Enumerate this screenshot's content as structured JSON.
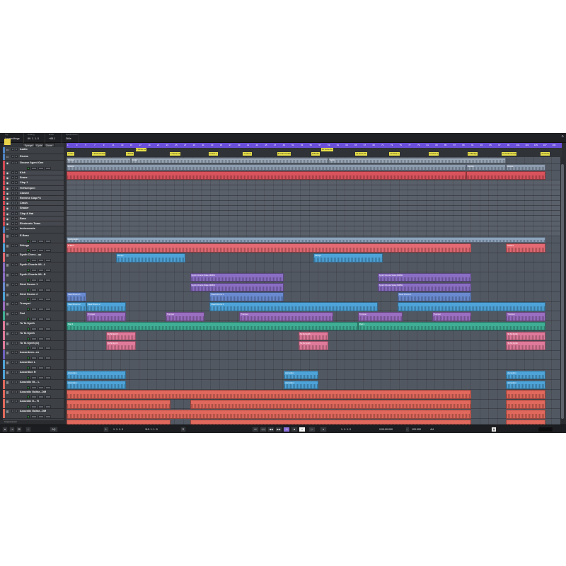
{
  "status": {
    "cells": [
      {
        "label": "Typ",
        "value": "Locatorlänge"
      },
      {
        "label": "Anfang",
        "value": "89. 1. 1. 0"
      },
      {
        "label": "Ende",
        "value": "+85.1"
      },
      {
        "label": "Spielposition",
        "value": "Stille"
      }
    ]
  },
  "tracklist_tabs": [
    "Spiegel",
    "Cycle",
    "Zoom"
  ],
  "tracks": [
    {
      "name": "Audio",
      "color": "#4e84c4",
      "type": "folder",
      "icon": "folder-icon"
    },
    {
      "name": "Drums",
      "color": "#4e84c4",
      "type": "folder",
      "icon": "folder-icon"
    },
    {
      "name": "Groove Agent One",
      "color": "#d24a55",
      "type": "instrument",
      "icon": "drum-icon"
    },
    {
      "name": "Kick",
      "color": "#d24a55",
      "type": "sub",
      "icon": "drum-icon"
    },
    {
      "name": "Snare",
      "color": "#d24a55",
      "type": "sub",
      "icon": "drum-icon"
    },
    {
      "name": "Clap 1",
      "color": "#d24a55",
      "type": "sub",
      "icon": "drum-icon"
    },
    {
      "name": "Hi Hat Open",
      "color": "#d24a55",
      "type": "sub",
      "icon": "drum-icon"
    },
    {
      "name": "Closed",
      "color": "#d24a55",
      "type": "sub",
      "icon": "drum-icon"
    },
    {
      "name": "Reverse Clap FX",
      "color": "#d24a55",
      "type": "sub",
      "icon": "drum-icon"
    },
    {
      "name": "Crash",
      "color": "#d24a55",
      "type": "sub",
      "icon": "drum-icon"
    },
    {
      "name": "Shaker",
      "color": "#d24a55",
      "type": "sub",
      "icon": "drum-icon"
    },
    {
      "name": "Clap & Hat",
      "color": "#d24a55",
      "type": "sub",
      "icon": "drum-icon"
    },
    {
      "name": "Bass",
      "color": "#d24a55",
      "type": "sub",
      "icon": "drum-icon"
    },
    {
      "name": "Electronic Toms",
      "color": "#d24a55",
      "type": "sub",
      "icon": "drum-icon"
    },
    {
      "name": "Instruments",
      "color": "#4e84c4",
      "type": "folder",
      "icon": "folder-icon"
    },
    {
      "name": "E-Bass",
      "color": "#e46a73",
      "type": "instrument",
      "icon": "piano-icon"
    },
    {
      "name": "Strings",
      "color": "#4ea3d8",
      "type": "instrument",
      "icon": "piano-icon"
    },
    {
      "name": "Synth Chrnc...up",
      "color": "#e46a73",
      "type": "instrument",
      "icon": "piano-icon"
    },
    {
      "name": "Synth Chords Wi...L",
      "color": "#8a6ec4",
      "type": "instrument",
      "icon": "piano-icon"
    },
    {
      "name": "Synth Chords Wi...R",
      "color": "#8a6ec4",
      "type": "instrument",
      "icon": "piano-icon"
    },
    {
      "name": "Steel Drums 1",
      "color": "#6a8ad0",
      "type": "instrument",
      "icon": "piano-icon"
    },
    {
      "name": "Steel Drums 2",
      "color": "#4ea3d8",
      "type": "instrument",
      "icon": "piano-icon"
    },
    {
      "name": "Trumpet",
      "color": "#9a6ec0",
      "type": "instrument",
      "icon": "piano-icon"
    },
    {
      "name": "Pad",
      "color": "#3fae95",
      "type": "instrument",
      "icon": "piano-icon"
    },
    {
      "name": "Ta Ta Synth",
      "color": "#e07a9a",
      "type": "instrument",
      "icon": "piano-icon"
    },
    {
      "name": "Ta Ta Synth",
      "color": "#e07a9a",
      "type": "instrument",
      "icon": "piano-icon"
    },
    {
      "name": "Ta Ta Synth (D)",
      "color": "#e07a9a",
      "type": "instrument",
      "icon": "piano-icon"
    },
    {
      "name": "Accordeon...ex",
      "color": "#6e62c0",
      "type": "instrument",
      "icon": "piano-icon"
    },
    {
      "name": "Accordion L",
      "color": "#4ea3d8",
      "type": "instrument",
      "icon": "piano-icon"
    },
    {
      "name": "Accordion R",
      "color": "#4ea3d8",
      "type": "instrument",
      "icon": "piano-icon"
    },
    {
      "name": "Acoustic Gt... L",
      "color": "#e0685c",
      "type": "instrument",
      "icon": "piano-icon"
    },
    {
      "name": "Acoustic Guitar...DM",
      "color": "#e0685c",
      "type": "instrument",
      "icon": "piano-icon"
    },
    {
      "name": "Acoustic G... R",
      "color": "#e0685c",
      "type": "instrument",
      "icon": "piano-icon"
    },
    {
      "name": "Acoustic Guitar...DM",
      "color": "#e0685c",
      "type": "instrument",
      "icon": "piano-icon"
    }
  ],
  "markers": [
    "1 Intro",
    "2 Instrumental",
    "3 Break",
    "4 Verse 1a",
    "5 Verse 1b",
    "6 Chor 1",
    "7 Chor 2",
    "8 Instrumental",
    "9 Break",
    "10 Verse 2a",
    "11 Verse 2b",
    "12 Chor 1",
    "13 Chor 2",
    "14 Bridge",
    "15 Instrumental",
    "16 Outro"
  ],
  "bar_numbers": [
    "1",
    "3",
    "5",
    "7",
    "9",
    "11",
    "13",
    "15",
    "17",
    "19",
    "21",
    "23",
    "25",
    "27",
    "29",
    "31",
    "33",
    "35",
    "37",
    "39",
    "41",
    "43",
    "45",
    "47",
    "49",
    "51",
    "53",
    "55",
    "57",
    "59",
    "61",
    "63",
    "65",
    "67",
    "69",
    "71",
    "73",
    "75",
    "77",
    "79",
    "81",
    "83",
    "85",
    "87",
    "89",
    "91",
    "93",
    "95",
    "97",
    "99",
    "101",
    "103",
    "105",
    "107",
    "109"
  ],
  "parts": [
    {
      "lane": 0,
      "start": 0.0,
      "end": 0.13,
      "label": "Drums",
      "color": "#9aa8b8"
    },
    {
      "lane": 0,
      "start": 0.13,
      "end": 0.53,
      "label": "Audio",
      "color": "#9aa8b8"
    },
    {
      "lane": 0,
      "start": 0.53,
      "end": 0.89,
      "label": "Audio",
      "color": "#9aa8b8"
    },
    {
      "lane": 1,
      "start": 0.0,
      "end": 0.81,
      "label": "Drums",
      "color": "#8e9caf"
    },
    {
      "lane": 1,
      "start": 0.81,
      "end": 0.89,
      "label": "Drums",
      "color": "#8e9caf"
    },
    {
      "lane": 1,
      "start": 0.89,
      "end": 0.97,
      "label": "Drums",
      "color": "#8e9caf"
    },
    {
      "lane": 2,
      "start": 0.0,
      "end": 0.81,
      "label": "",
      "color": "#d9535d"
    },
    {
      "lane": 2,
      "start": 0.81,
      "end": 0.97,
      "label": "",
      "color": "#d9535d"
    },
    {
      "lane": 14,
      "start": 0.0,
      "end": 0.97,
      "label": "Instruments",
      "color": "#8ea4bd"
    },
    {
      "lane": 15,
      "start": 0.0,
      "end": 0.82,
      "label": "E-Bass",
      "color": "#e46a73"
    },
    {
      "lane": 15,
      "start": 0.89,
      "end": 0.97,
      "label": "E-Bass",
      "color": "#e46a73"
    },
    {
      "lane": 16,
      "start": 0.1,
      "end": 0.24,
      "label": "Strings",
      "color": "#4ea3d8"
    },
    {
      "lane": 16,
      "start": 0.5,
      "end": 0.64,
      "label": "Strings",
      "color": "#4ea3d8"
    },
    {
      "lane": 18,
      "start": 0.25,
      "end": 0.44,
      "label": "Synth Chords Wide NDBW",
      "color": "#8a6ec4"
    },
    {
      "lane": 18,
      "start": 0.63,
      "end": 0.82,
      "label": "Synth Chords Wide NDBW",
      "color": "#8a6ec4"
    },
    {
      "lane": 19,
      "start": 0.25,
      "end": 0.44,
      "label": "Synth Chords Wide NDBW",
      "color": "#8a6ec4"
    },
    {
      "lane": 19,
      "start": 0.63,
      "end": 0.82,
      "label": "Synth Chords Wide NDBW",
      "color": "#8a6ec4"
    },
    {
      "lane": 20,
      "start": 0.0,
      "end": 0.04,
      "label": "Steel Drums 1",
      "color": "#6a8ad0"
    },
    {
      "lane": 20,
      "start": 0.29,
      "end": 0.44,
      "label": "Steel Drums 1",
      "color": "#6a8ad0"
    },
    {
      "lane": 20,
      "start": 0.67,
      "end": 0.82,
      "label": "Steel Drums 1",
      "color": "#6a8ad0"
    },
    {
      "lane": 21,
      "start": 0.0,
      "end": 0.04,
      "label": "Steel Drums 2",
      "color": "#4ea3d8"
    },
    {
      "lane": 21,
      "start": 0.04,
      "end": 0.12,
      "label": "Steel Drums 2",
      "color": "#4ea3d8"
    },
    {
      "lane": 21,
      "start": 0.29,
      "end": 0.63,
      "label": "Steel Drums 2",
      "color": "#4ea3d8"
    },
    {
      "lane": 21,
      "start": 0.67,
      "end": 0.97,
      "label": "",
      "color": "#4ea3d8"
    },
    {
      "lane": 22,
      "start": 0.04,
      "end": 0.12,
      "label": "Trumpet",
      "color": "#9a6ec0"
    },
    {
      "lane": 22,
      "start": 0.2,
      "end": 0.28,
      "label": "Trumpet",
      "color": "#9a6ec0"
    },
    {
      "lane": 22,
      "start": 0.35,
      "end": 0.54,
      "label": "Trumpet",
      "color": "#9a6ec0"
    },
    {
      "lane": 22,
      "start": 0.59,
      "end": 0.68,
      "label": "Trumpet",
      "color": "#9a6ec0"
    },
    {
      "lane": 22,
      "start": 0.74,
      "end": 0.82,
      "label": "Trumpet",
      "color": "#9a6ec0"
    },
    {
      "lane": 22,
      "start": 0.89,
      "end": 0.97,
      "label": "Trumpet",
      "color": "#9a6ec0"
    },
    {
      "lane": 23,
      "start": 0.0,
      "end": 0.59,
      "label": "Pad 1",
      "color": "#3fae95"
    },
    {
      "lane": 23,
      "start": 0.59,
      "end": 0.97,
      "label": "Pad 1",
      "color": "#3fae95"
    },
    {
      "lane": 24,
      "start": 0.08,
      "end": 0.14,
      "label": "Ta Ta Synth",
      "color": "#e07a9a"
    },
    {
      "lane": 24,
      "start": 0.47,
      "end": 0.53,
      "label": "Ta Ta Synth",
      "color": "#e07a9a"
    },
    {
      "lane": 24,
      "start": 0.89,
      "end": 0.97,
      "label": "Ta Ta Synth",
      "color": "#e07a9a"
    },
    {
      "lane": 25,
      "start": 0.08,
      "end": 0.14,
      "label": "Ta Ta Synth",
      "color": "#e07a9a"
    },
    {
      "lane": 25,
      "start": 0.47,
      "end": 0.53,
      "label": "Ta Ta Synth",
      "color": "#e07a9a"
    },
    {
      "lane": 25,
      "start": 0.89,
      "end": 0.97,
      "label": "Ta Ta Synth",
      "color": "#e07a9a"
    },
    {
      "lane": 28,
      "start": 0.0,
      "end": 0.12,
      "label": "Accordion",
      "color": "#4ea3d8"
    },
    {
      "lane": 28,
      "start": 0.44,
      "end": 0.51,
      "label": "Accordion",
      "color": "#4ea3d8"
    },
    {
      "lane": 28,
      "start": 0.89,
      "end": 0.97,
      "label": "Accordion",
      "color": "#4ea3d8"
    },
    {
      "lane": 29,
      "start": 0.0,
      "end": 0.12,
      "label": "Accordion",
      "color": "#4ea3d8"
    },
    {
      "lane": 29,
      "start": 0.44,
      "end": 0.51,
      "label": "Accordion",
      "color": "#4ea3d8"
    },
    {
      "lane": 29,
      "start": 0.89,
      "end": 0.97,
      "label": "Accordion",
      "color": "#4ea3d8"
    },
    {
      "lane": 30,
      "start": 0.0,
      "end": 0.82,
      "label": "",
      "color": "#e0685c"
    },
    {
      "lane": 30,
      "start": 0.89,
      "end": 0.97,
      "label": "",
      "color": "#e0685c"
    },
    {
      "lane": 31,
      "start": 0.0,
      "end": 0.21,
      "label": "",
      "color": "#e0685c"
    },
    {
      "lane": 31,
      "start": 0.25,
      "end": 0.82,
      "label": "",
      "color": "#e0685c"
    },
    {
      "lane": 31,
      "start": 0.89,
      "end": 0.97,
      "label": "",
      "color": "#e0685c"
    },
    {
      "lane": 32,
      "start": 0.0,
      "end": 0.82,
      "label": "",
      "color": "#e0685c"
    },
    {
      "lane": 32,
      "start": 0.89,
      "end": 0.97,
      "label": "",
      "color": "#e0685c"
    },
    {
      "lane": 33,
      "start": 0.0,
      "end": 0.21,
      "label": "",
      "color": "#e0685c"
    },
    {
      "lane": 33,
      "start": 0.25,
      "end": 0.82,
      "label": "",
      "color": "#e0685c"
    },
    {
      "lane": 33,
      "start": 0.89,
      "end": 0.97,
      "label": "",
      "color": "#e0685c"
    }
  ],
  "transport": {
    "left_locator": "1. 1. 1. 0",
    "right_locator": "110. 1. 1. 0",
    "position": "1. 1. 1. 0",
    "time": "0:00:00.000",
    "tempo": "120.000",
    "signature": "4/4"
  },
  "footer_label": "Gruppenspuren"
}
